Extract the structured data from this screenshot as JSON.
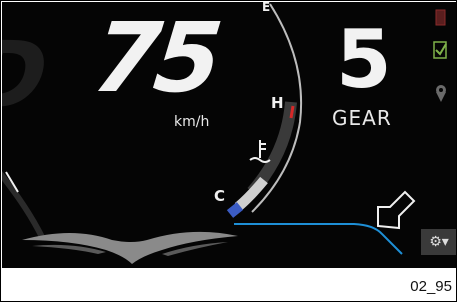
{
  "speed": {
    "value": "75",
    "unit": "km/h"
  },
  "gear": {
    "value": "5",
    "label": "GEAR"
  },
  "temperature_gauge": {
    "high_label": "H",
    "low_label": "C",
    "top_label": "E"
  },
  "left_gauge": {
    "label": "D"
  },
  "status_icons": [
    "battery-icon",
    "checklist-icon",
    "location-pin-icon"
  ],
  "settings_button": {
    "icon": "gear-icon"
  },
  "caption": "02_95",
  "colors": {
    "background": "#050505",
    "accent_blue": "#1e8fd6",
    "warning_red": "#d62828"
  }
}
